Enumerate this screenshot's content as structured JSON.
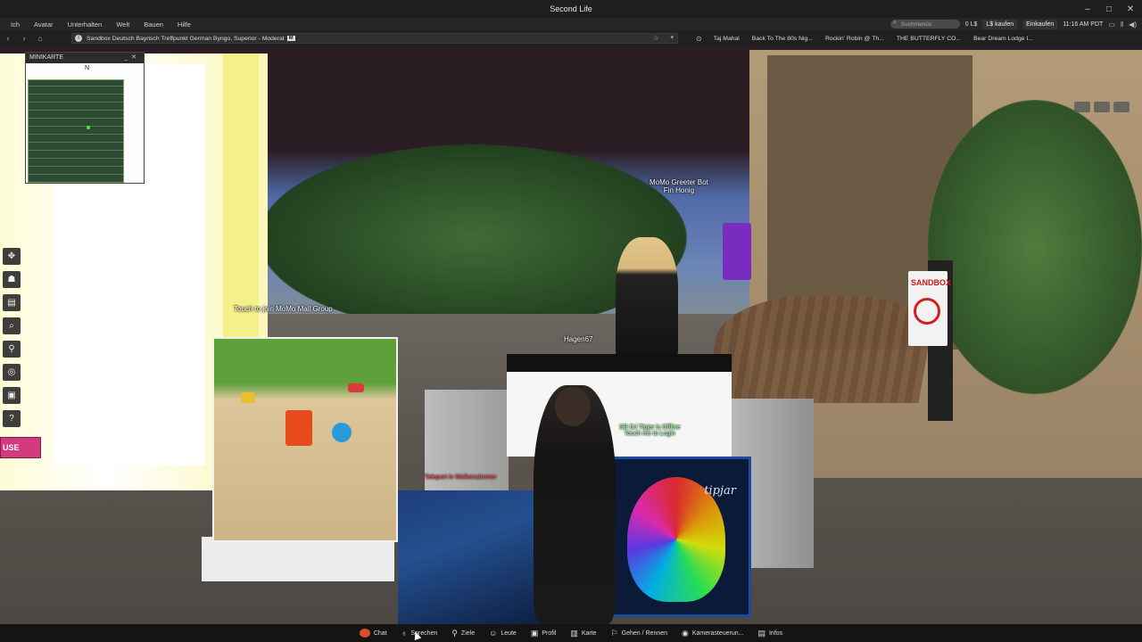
{
  "window": {
    "title": "Second Life",
    "controls": [
      "–",
      "□",
      "✕"
    ]
  },
  "menubar": {
    "items": [
      "Ich",
      "Avatar",
      "Unterhalten",
      "Welt",
      "Bauen",
      "Hilfe"
    ],
    "search_placeholder": "Suchmenüs",
    "balance": "0 L$",
    "buy_linden": "L$ kaufen",
    "shop": "Einkaufen",
    "time": "11:16 AM PDT"
  },
  "navbar": {
    "location": "Sandbox Deutsch Bayrisch Treffpunkt German Byngo, Superior - Moderat",
    "maturity_badge": "M",
    "favorites": [
      "Taj Mahal",
      "Back To The 80s Nig...",
      "Rockin' Robin @ Th...",
      "THE BUTTERFLY CO...",
      "Bear Dream Lodge I..."
    ]
  },
  "minimap": {
    "title": "MINIKARTE",
    "north": "N",
    "controls": [
      "_",
      "✕"
    ]
  },
  "scene": {
    "labels": {
      "greeter_name": "MoMo Greeter Bot",
      "greeter_sub": "Fin Honig",
      "touch_group": "Touch to join MoMo Mall Group",
      "avatar_name": "Hagen67",
      "dj_status_1": "SR DJ Tipjar is Offline",
      "dj_status_2": "Touch me to Login",
      "teleport": "Teleport in Wolkenzimmer",
      "sandbox_sign": "SANDBOX",
      "dj_brand": "tipjar",
      "pink_tag": "USE"
    }
  },
  "bottombar": {
    "buttons": [
      {
        "label": "Chat",
        "icon": "chat-icon"
      },
      {
        "label": "Sprechen",
        "icon": "microphone-icon"
      },
      {
        "label": "Ziele",
        "icon": "destination-icon"
      },
      {
        "label": "Leute",
        "icon": "people-icon"
      },
      {
        "label": "Profil",
        "icon": "profile-icon"
      },
      {
        "label": "Karte",
        "icon": "map-icon"
      },
      {
        "label": "Gehen / Rennen",
        "icon": "walk-icon"
      },
      {
        "label": "Kamerasteuerun...",
        "icon": "camera-icon"
      },
      {
        "label": "Infos",
        "icon": "info-icon"
      }
    ]
  },
  "left_toolbar": {
    "icons": [
      "move-icon",
      "appearance-icon",
      "inventory-icon",
      "search-icon",
      "places-icon",
      "snapshot-icon",
      "camera-icon",
      "help-icon"
    ]
  }
}
